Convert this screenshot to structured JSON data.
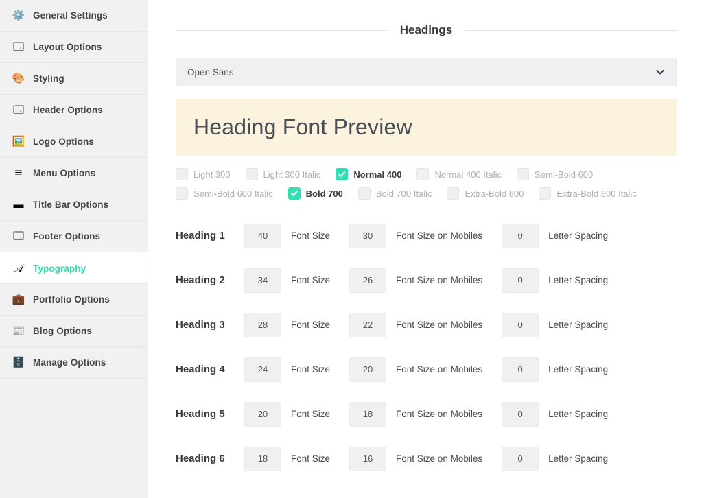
{
  "sidebar": {
    "items": [
      {
        "label": "General Settings",
        "icon": "gear-icon",
        "glyph": "⚙️",
        "active": false
      },
      {
        "label": "Layout Options",
        "icon": "layout-icon",
        "glyph": "🗔️",
        "active": false
      },
      {
        "label": "Styling",
        "icon": "color-wheel-icon",
        "glyph": "🎨",
        "active": false
      },
      {
        "label": "Header Options",
        "icon": "header-icon",
        "glyph": "🗔️",
        "active": false
      },
      {
        "label": "Logo Options",
        "icon": "image-icon",
        "glyph": "🖼️",
        "active": false
      },
      {
        "label": "Menu Options",
        "icon": "menu-list-icon",
        "glyph": "≣",
        "active": false
      },
      {
        "label": "Title Bar Options",
        "icon": "title-bar-icon",
        "glyph": "▬",
        "active": false
      },
      {
        "label": "Footer Options",
        "icon": "footer-icon",
        "glyph": "🗔️",
        "active": false
      },
      {
        "label": "Typography",
        "icon": "letter-a-icon",
        "glyph": "𝒜",
        "active": true
      },
      {
        "label": "Portfolio Options",
        "icon": "briefcase-icon",
        "glyph": "💼",
        "active": false
      },
      {
        "label": "Blog Options",
        "icon": "newspaper-icon",
        "glyph": "📰",
        "active": false
      },
      {
        "label": "Manage Options",
        "icon": "archive-icon",
        "glyph": "🗄️",
        "active": false
      }
    ]
  },
  "main": {
    "section_title": "Headings",
    "font_select": {
      "value": "Open Sans",
      "chevron_icon": "chevron-down-icon"
    },
    "preview_text": "Heading Font Preview",
    "weights": [
      {
        "label": "Light 300",
        "checked": false
      },
      {
        "label": "Light 300 Italic",
        "checked": false
      },
      {
        "label": "Normal 400",
        "checked": true
      },
      {
        "label": "Normal 400 Italic",
        "checked": false
      },
      {
        "label": "Semi-Bold 600",
        "checked": false
      },
      {
        "label": "Semi-Bold 600 Italic",
        "checked": false
      },
      {
        "label": "Bold 700",
        "checked": true
      },
      {
        "label": "Bold 700 Italic",
        "checked": false
      },
      {
        "label": "Extra-Bold 800",
        "checked": false
      },
      {
        "label": "Extra-Bold 800 Italic",
        "checked": false
      }
    ],
    "field_labels": {
      "font_size": "Font Size",
      "font_size_mobiles": "Font Size on Mobiles",
      "letter_spacing": "Letter Spacing"
    },
    "headings": [
      {
        "name": "Heading 1",
        "font_size": "40",
        "font_size_mobiles": "30",
        "letter_spacing": "0"
      },
      {
        "name": "Heading 2",
        "font_size": "34",
        "font_size_mobiles": "26",
        "letter_spacing": "0"
      },
      {
        "name": "Heading 3",
        "font_size": "28",
        "font_size_mobiles": "22",
        "letter_spacing": "0"
      },
      {
        "name": "Heading 4",
        "font_size": "24",
        "font_size_mobiles": "20",
        "letter_spacing": "0"
      },
      {
        "name": "Heading 5",
        "font_size": "20",
        "font_size_mobiles": "18",
        "letter_spacing": "0"
      },
      {
        "name": "Heading 6",
        "font_size": "18",
        "font_size_mobiles": "16",
        "letter_spacing": "0"
      }
    ]
  },
  "colors": {
    "accent": "#33dfb2",
    "sidebar_bg": "#f1f1f1",
    "preview_bg": "#fbf3dd",
    "field_bg": "#f0f0f0",
    "text_dark": "#3a3a3a",
    "text_muted": "#b0b0b0"
  }
}
